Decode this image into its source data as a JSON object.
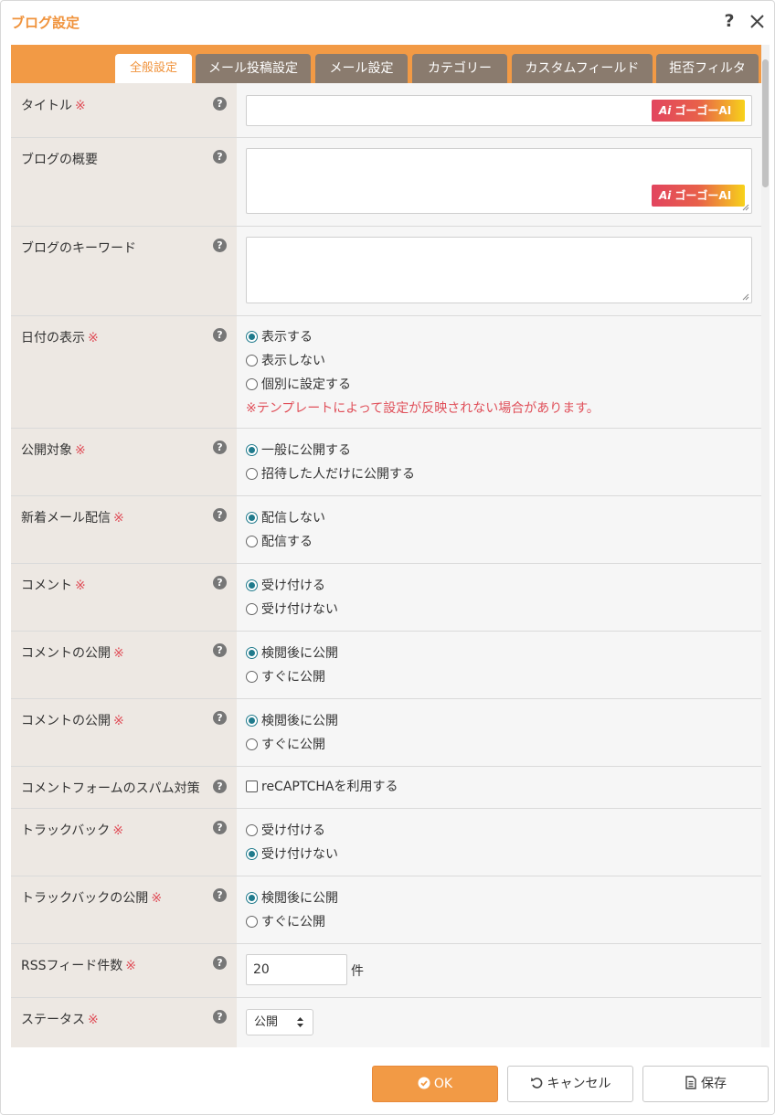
{
  "dialog": {
    "title": "ブログ設定",
    "help_label": "?"
  },
  "tabs": [
    {
      "label": "全般設定",
      "active": true
    },
    {
      "label": "メール投稿設定"
    },
    {
      "label": "メール設定"
    },
    {
      "label": "カテゴリー"
    },
    {
      "label": "カスタムフィールド"
    },
    {
      "label": "拒否フィルタ"
    }
  ],
  "required_mark": "※",
  "help_icon_glyph": "?",
  "ai_button_label": "ゴーゴーAI",
  "ai_button_glyph": "Ai",
  "fields": {
    "title": {
      "label": "タイトル",
      "value": ""
    },
    "summary": {
      "label": "ブログの概要",
      "value": ""
    },
    "keywords": {
      "label": "ブログのキーワード",
      "value": ""
    },
    "date_display": {
      "label": "日付の表示",
      "options": [
        "表示する",
        "表示しない",
        "個別に設定する"
      ],
      "selected": 0,
      "note": "※テンプレートによって設定が反映されない場合があります。"
    },
    "visibility": {
      "label": "公開対象",
      "options": [
        "一般に公開する",
        "招待した人だけに公開する"
      ],
      "selected": 0
    },
    "new_mail": {
      "label": "新着メール配信",
      "options": [
        "配信しない",
        "配信する"
      ],
      "selected": 0
    },
    "comment": {
      "label": "コメント",
      "options": [
        "受け付ける",
        "受け付けない"
      ],
      "selected": 0
    },
    "comment_publish_1": {
      "label": "コメントの公開",
      "options": [
        "検閲後に公開",
        "すぐに公開"
      ],
      "selected": 0
    },
    "comment_publish_2": {
      "label": "コメントの公開",
      "options": [
        "検閲後に公開",
        "すぐに公開"
      ],
      "selected": 0
    },
    "spam": {
      "label": "コメントフォームのスパム対策",
      "checkbox_label": "reCAPTCHAを利用する",
      "checked": false
    },
    "trackback": {
      "label": "トラックバック",
      "options": [
        "受け付ける",
        "受け付けない"
      ],
      "selected": 1
    },
    "trackback_publish": {
      "label": "トラックバックの公開",
      "options": [
        "検閲後に公開",
        "すぐに公開"
      ],
      "selected": 0
    },
    "rss": {
      "label": "RSSフィード件数",
      "value": "20",
      "unit": "件"
    },
    "status": {
      "label": "ステータス",
      "value": "公開"
    }
  },
  "footer": {
    "ok_label": "OK",
    "cancel_label": "キャンセル",
    "save_label": "保存"
  },
  "colors": {
    "accent": "#f29a45",
    "tab_inactive": "#8a7b6e",
    "radio": "#1f7a8c",
    "required": "#e0505a"
  }
}
